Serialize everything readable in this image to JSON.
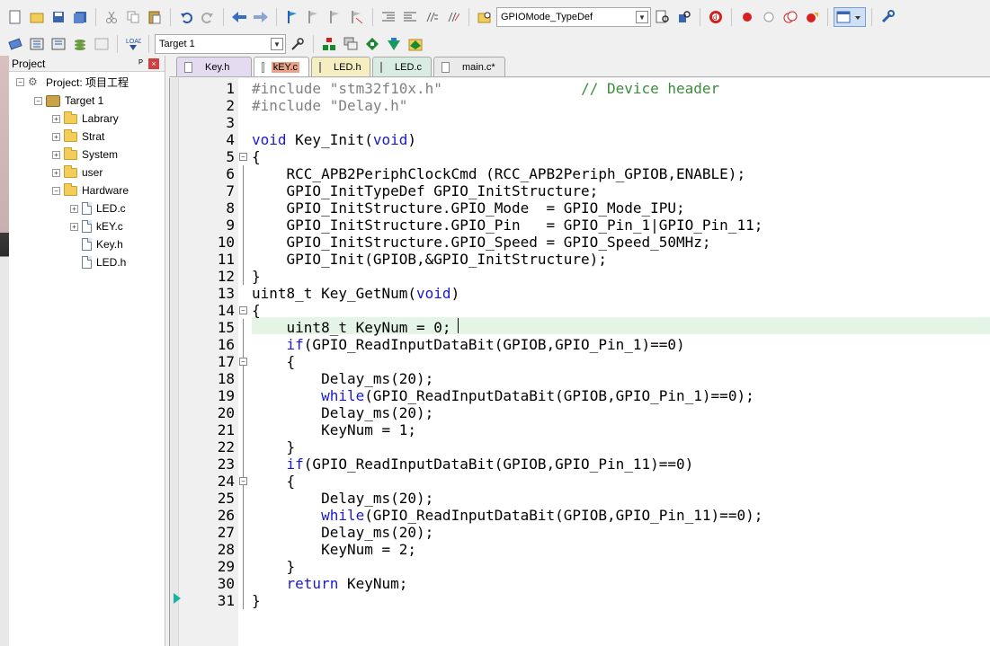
{
  "toolbar1": {
    "function_combo": "GPIOMode_TypeDef"
  },
  "toolbar2": {
    "target_combo": "Target 1"
  },
  "project_panel": {
    "title": "Project",
    "pin_glyph": "ᴾ",
    "close_glyph": "×",
    "root": "Project: 项目工程",
    "target": "Target 1",
    "groups": [
      "Labrary",
      "Strat",
      "System",
      "user",
      "Hardware"
    ],
    "hardware_files": [
      "LED.c",
      "kEY.c",
      "Key.h",
      "LED.h"
    ]
  },
  "tabs": [
    "Key.h",
    "kEY.c",
    "LED.h",
    "LED.c",
    "main.c*"
  ],
  "editor": {
    "line_numbers": [
      "1",
      "2",
      "3",
      "4",
      "5",
      "6",
      "7",
      "8",
      "9",
      "10",
      "11",
      "12",
      "13",
      "14",
      "15",
      "16",
      "17",
      "18",
      "19",
      "20",
      "21",
      "22",
      "23",
      "24",
      "25",
      "26",
      "27",
      "28",
      "29",
      "30",
      "31"
    ]
  },
  "code": {
    "l1_a": "#include ",
    "l1_b": "\"stm32f10x.h\"",
    "l1_c": "                // Device header",
    "l2_a": "#include ",
    "l2_b": "\"Delay.h\"",
    "l4_a": "void",
    "l4_b": " Key_Init(",
    "l4_c": "void",
    "l4_d": ")",
    "l5": "{",
    "l6": "    RCC_APB2PeriphClockCmd (RCC_APB2Periph_GPIOB,ENABLE);",
    "l7": "    GPIO_InitTypeDef GPIO_InitStructure;",
    "l8": "    GPIO_InitStructure.GPIO_Mode  = GPIO_Mode_IPU;",
    "l9": "    GPIO_InitStructure.GPIO_Pin   = GPIO_Pin_1|GPIO_Pin_11;",
    "l10": "    GPIO_InitStructure.GPIO_Speed = GPIO_Speed_50MHz;",
    "l11": "    GPIO_Init(GPIOB,&GPIO_InitStructure);",
    "l12": "}",
    "l13_a": "uint8_t Key_GetNum(",
    "l13_b": "void",
    "l13_c": ")",
    "l14": "{",
    "l15": "    uint8_t KeyNum = 0;",
    "l16_a": "    ",
    "l16_b": "if",
    "l16_c": "(GPIO_ReadInputDataBit(GPIOB,GPIO_Pin_1)==0)",
    "l17": "    {",
    "l18": "        Delay_ms(20);",
    "l19_a": "        ",
    "l19_b": "while",
    "l19_c": "(GPIO_ReadInputDataBit(GPIOB,GPIO_Pin_1)==0);",
    "l20": "        Delay_ms(20);",
    "l21": "        KeyNum = 1;",
    "l22": "    }",
    "l23_a": "    ",
    "l23_b": "if",
    "l23_c": "(GPIO_ReadInputDataBit(GPIOB,GPIO_Pin_11)==0)",
    "l24": "    {",
    "l25": "        Delay_ms(20);",
    "l26_a": "        ",
    "l26_b": "while",
    "l26_c": "(GPIO_ReadInputDataBit(GPIOB,GPIO_Pin_11)==0);",
    "l27": "        Delay_ms(20);",
    "l28": "        KeyNum = 2;",
    "l29": "    }",
    "l30_a": "    ",
    "l30_b": "return",
    "l30_c": " KeyNum;",
    "l31": "}"
  }
}
